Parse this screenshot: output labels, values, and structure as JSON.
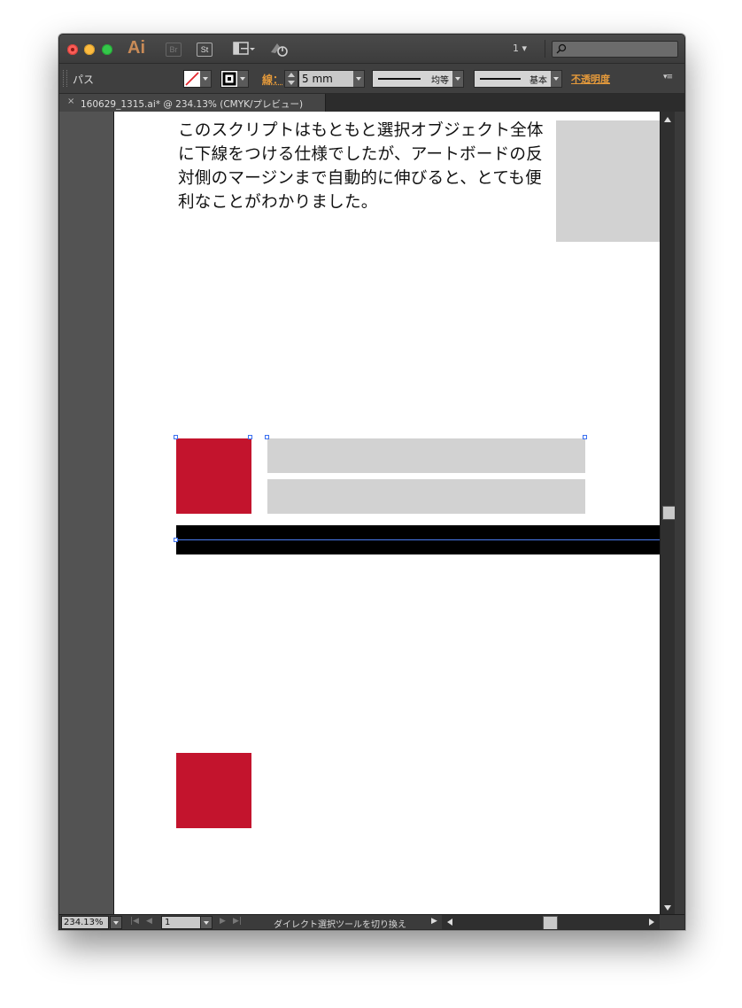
{
  "titlebar": {
    "app_logo": "Ai",
    "bridge_label": "Br",
    "stock_label": "St",
    "artboard_number": "1 ▾",
    "search_placeholder": ""
  },
  "controlbar": {
    "selection_label": "パス",
    "stroke_label": "線：",
    "stroke_weight": "5 mm",
    "profile_label": "均等",
    "brush_label": "基本",
    "opacity_label": "不透明度",
    "panel_menu": "▾≡"
  },
  "document": {
    "tab_close": "×",
    "tab_title": "160629_1315.ai* @ 234.13% (CMYK/プレビュー)"
  },
  "artboard": {
    "body_text": "このスクリプトはもともと選択オブジェクト全体に下線をつける仕様でしたが、アートボードの反対側のマージンまで自動的に伸びると、とても便利なことがわかりました。"
  },
  "statusbar": {
    "zoom": "234.13%",
    "page": "1",
    "nav_first": "|◀",
    "nav_prev": "◀",
    "nav_next": "▶",
    "nav_last": "▶|",
    "status_text": "ダイレクト選択ツールを切り換え",
    "status_play": "▶"
  },
  "colors": {
    "red_fill": "#c3142d",
    "gray_fill": "#d2d2d2",
    "accent": "#e59a3b"
  },
  "icons": [
    "close-icon",
    "minimize-icon",
    "maximize-icon",
    "bridge-icon",
    "stock-icon",
    "layout-icon",
    "sync-icon",
    "search-icon",
    "no-fill-icon",
    "stroke-swatch-icon",
    "stepper-icon",
    "chevron-down-icon",
    "scroll-up-icon",
    "scroll-down-icon",
    "scroll-left-icon",
    "scroll-right-icon"
  ]
}
